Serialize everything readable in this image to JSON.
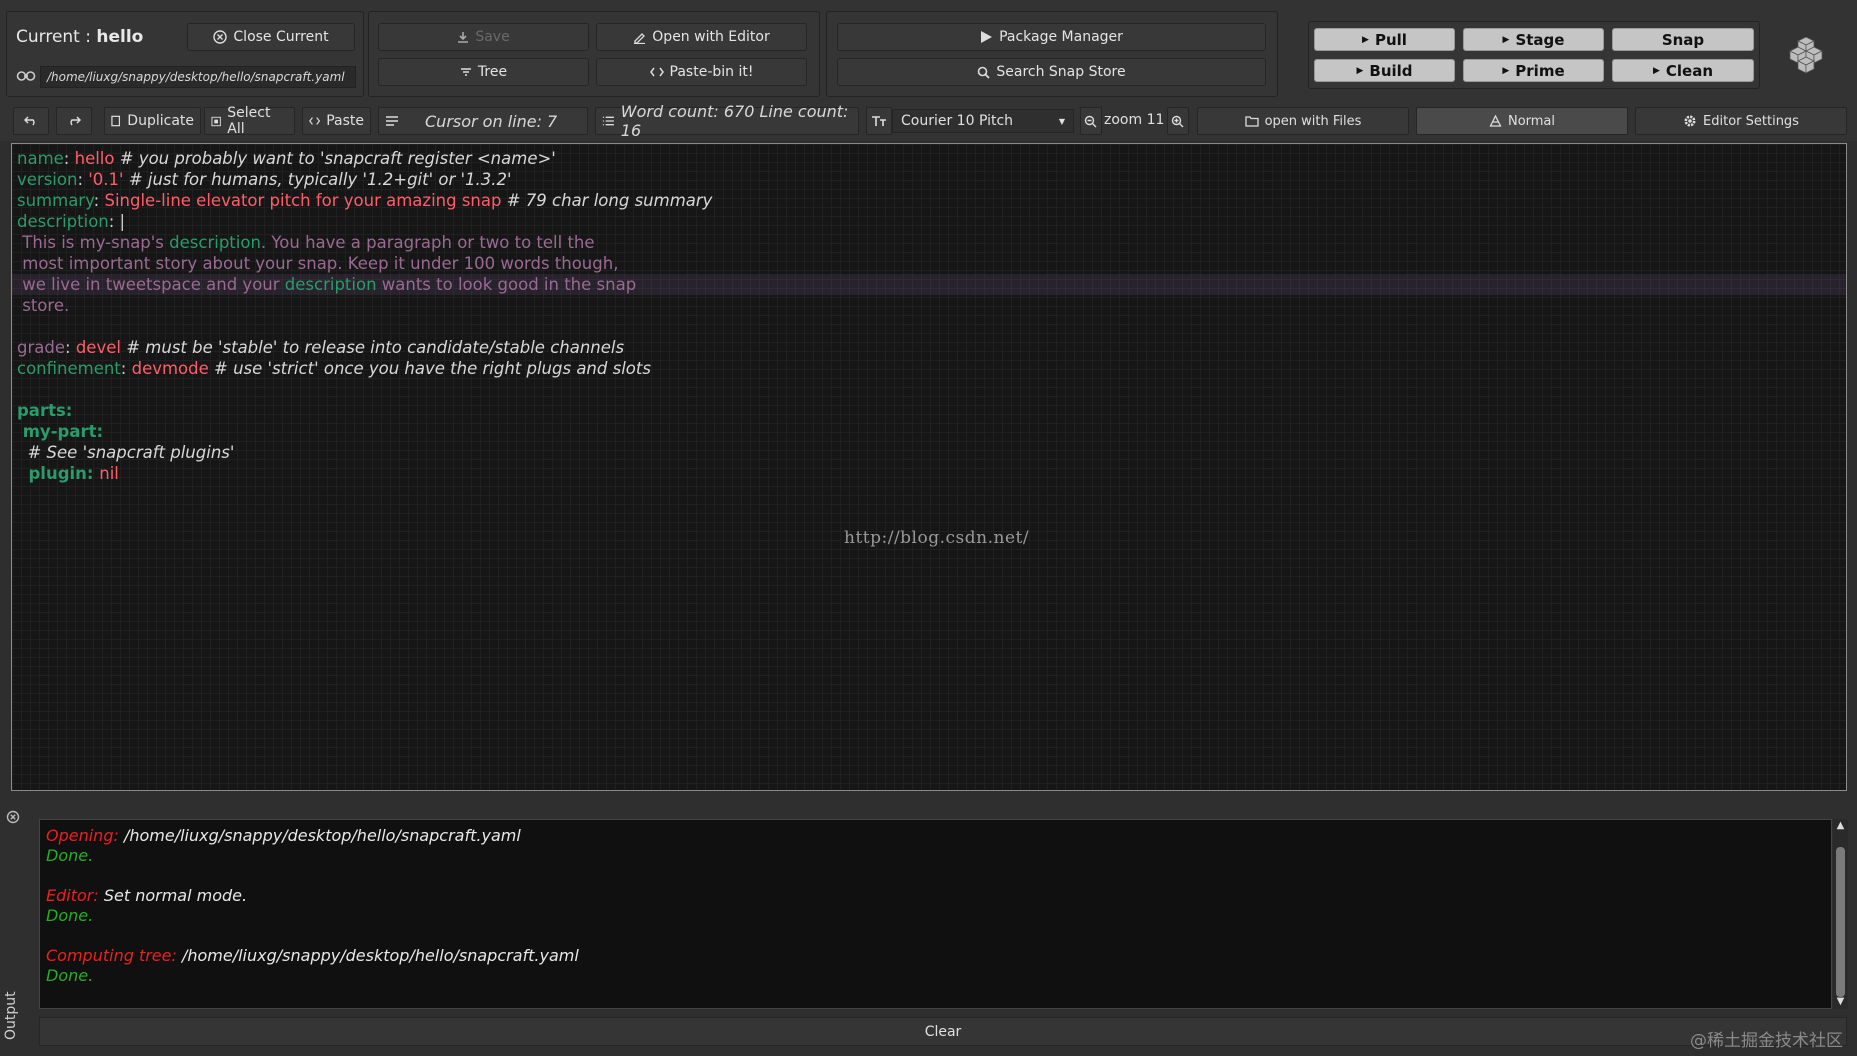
{
  "header": {
    "current_label": "Current : ",
    "current_name": "hello",
    "close_current": "Close Current",
    "path": "/home/liuxg/snappy/desktop/hello/snapcraft.yaml",
    "save": "Save",
    "open_with_editor": "Open with Editor",
    "tree": "Tree",
    "paste_bin": "Paste-bin it!",
    "package_manager": "Package Manager",
    "search_snap_store": "Search Snap Store",
    "pull": "Pull",
    "stage": "Stage",
    "snap": "Snap",
    "build": "Build",
    "prime": "Prime",
    "clean": "Clean"
  },
  "toolbar": {
    "duplicate": "Duplicate",
    "select_all": "Select All",
    "paste": "Paste",
    "cursor_info": "Cursor on line:  7",
    "count_info": "Word count: 670 Line count: 16",
    "font_name": "Courier 10 Pitch",
    "zoom": "zoom 11",
    "open_with_files": "open with Files",
    "mode": "Normal",
    "editor_settings": "Editor Settings"
  },
  "editor": {
    "lines": [
      [
        {
          "t": "name",
          "c": "k-green"
        },
        {
          "t": ": ",
          "c": "plain"
        },
        {
          "t": "hello ",
          "c": "v-red"
        },
        {
          "t": "# you probably want to 'snapcraft register <name>'",
          "c": "c-com"
        }
      ],
      [
        {
          "t": "version",
          "c": "k-green"
        },
        {
          "t": ": ",
          "c": "plain"
        },
        {
          "t": "'0.1' ",
          "c": "v-red"
        },
        {
          "t": "# just for humans, typically '1.2+git' or '1.3.2'",
          "c": "c-com"
        }
      ],
      [
        {
          "t": "summary",
          "c": "k-green"
        },
        {
          "t": ": ",
          "c": "plain"
        },
        {
          "t": "Single-line elevator pitch for your amazing snap ",
          "c": "v-red"
        },
        {
          "t": "# 79 char long summary",
          "c": "c-com"
        }
      ],
      [
        {
          "t": "description",
          "c": "k-green"
        },
        {
          "t": ": |",
          "c": "plain"
        }
      ],
      [
        {
          "t": " This is my-snap's ",
          "c": "purple"
        },
        {
          "t": "description",
          "c": "k-green"
        },
        {
          "t": ". You have a paragraph or two to tell the",
          "c": "purple"
        }
      ],
      [
        {
          "t": " most important story about your snap. Keep it under 100 words though,",
          "c": "purple"
        }
      ],
      [
        {
          "t": " we live in tweetspace and your ",
          "c": "purple"
        },
        {
          "t": "description",
          "c": "k-green"
        },
        {
          "t": " wants to look good in the snap",
          "c": "purple"
        }
      ],
      [
        {
          "t": " store.",
          "c": "purple"
        }
      ],
      [],
      [
        {
          "t": "grade",
          "c": "purple"
        },
        {
          "t": ": ",
          "c": "plain"
        },
        {
          "t": "devel ",
          "c": "v-red"
        },
        {
          "t": "# must be 'stable' to release into candidate/stable channels",
          "c": "c-com"
        }
      ],
      [
        {
          "t": "confinement",
          "c": "k-green"
        },
        {
          "t": ": ",
          "c": "plain"
        },
        {
          "t": "devmode ",
          "c": "v-red"
        },
        {
          "t": "# use 'strict' once you have the right plugs and slots",
          "c": "c-com"
        }
      ],
      [],
      [
        {
          "t": "parts:",
          "c": "k-green-b"
        }
      ],
      [
        {
          "t": " my-part:",
          "c": "k-green-b"
        }
      ],
      [
        {
          "t": "  # See 'snapcraft plugins'",
          "c": "c-com"
        }
      ],
      [
        {
          "t": "  plugin: ",
          "c": "k-green-b"
        },
        {
          "t": "nil",
          "c": "v-red"
        }
      ]
    ],
    "watermark": "http://blog.csdn.net/"
  },
  "output": {
    "label": "Output",
    "lines": [
      [
        {
          "t": "Opening: ",
          "c": "o-red"
        },
        {
          "t": "/home/liuxg/snappy/desktop/hello/snapcraft.yaml",
          "c": "o-white"
        }
      ],
      [
        {
          "t": "Done.",
          "c": "o-green"
        }
      ],
      [],
      [
        {
          "t": "Editor: ",
          "c": "o-red"
        },
        {
          "t": "Set normal mode.",
          "c": "o-white"
        }
      ],
      [
        {
          "t": "Done.",
          "c": "o-green"
        }
      ],
      [],
      [
        {
          "t": "Computing tree: ",
          "c": "o-red"
        },
        {
          "t": "/home/liuxg/snappy/desktop/hello/snapcraft.yaml",
          "c": "o-white"
        }
      ],
      [
        {
          "t": "Done.",
          "c": "o-green"
        }
      ]
    ],
    "clear": "Clear"
  },
  "credit": "@稀土掘金技术社区",
  "icons": [
    "close-circle-icon",
    "link-icon",
    "download-icon",
    "pen-icon",
    "filter-icon",
    "code-icon",
    "play-icon",
    "search-icon",
    "undo-icon",
    "redo-icon",
    "duplicate-icon",
    "select-all-icon",
    "paste-icon",
    "align-icon",
    "list-icon",
    "font-size-icon",
    "zoom-out-icon",
    "zoom-in-icon",
    "folder-icon",
    "cone-icon",
    "gear-icon",
    "snapcraft-logo-icon"
  ]
}
